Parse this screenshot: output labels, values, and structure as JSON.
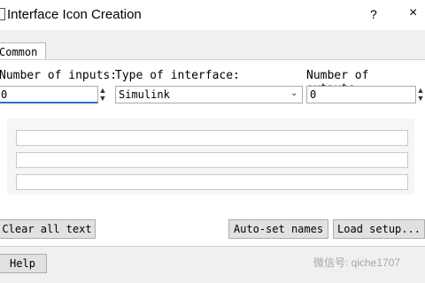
{
  "window": {
    "title": "Interface Icon Creation",
    "help": "?",
    "close": "×"
  },
  "tabs": [
    {
      "label": "Common"
    }
  ],
  "labels": {
    "num_inputs": "Number of inputs:",
    "type_interface": "Type of interface:",
    "num_outputs": "Number of outputs:"
  },
  "fields": {
    "num_inputs_value": "0",
    "type_interface_value": "Simulink",
    "num_outputs_value": "0"
  },
  "buttons": {
    "clear_all": "Clear all text",
    "auto_set": "Auto-set names",
    "load_setup": "Load setup...",
    "help": "Help"
  },
  "watermark": {
    "text": "微信号: qiche1707"
  }
}
